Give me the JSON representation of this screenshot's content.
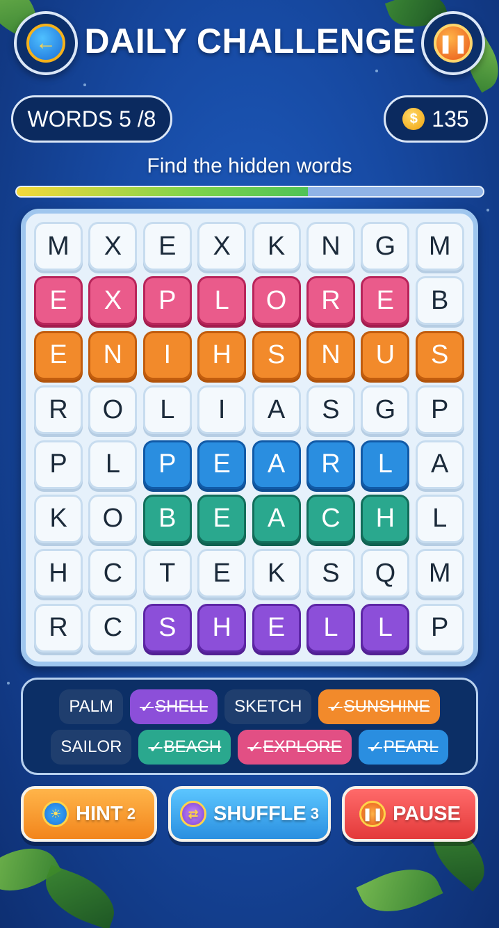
{
  "header": {
    "title": "DAILY CHALLENGE",
    "back_icon": "arrow-left-icon",
    "pause_icon": "pause-icon"
  },
  "status": {
    "words_label": "WORDS 5 /8",
    "coins": "135",
    "coin_symbol": "$"
  },
  "instruction": "Find the hidden words",
  "progress": {
    "fraction": 0.625
  },
  "grid": [
    [
      "M",
      "X",
      "E",
      "X",
      "K",
      "N",
      "G",
      "M"
    ],
    [
      "E",
      "X",
      "P",
      "L",
      "O",
      "R",
      "E",
      "B"
    ],
    [
      "E",
      "N",
      "I",
      "H",
      "S",
      "N",
      "U",
      "S"
    ],
    [
      "R",
      "O",
      "L",
      "I",
      "A",
      "S",
      "G",
      "P"
    ],
    [
      "P",
      "L",
      "P",
      "E",
      "A",
      "R",
      "L",
      "A"
    ],
    [
      "K",
      "O",
      "B",
      "E",
      "A",
      "C",
      "H",
      "L"
    ],
    [
      "H",
      "C",
      "T",
      "E",
      "K",
      "S",
      "Q",
      "M"
    ],
    [
      "R",
      "C",
      "S",
      "H",
      "E",
      "L",
      "L",
      "P"
    ]
  ],
  "highlights": [
    {
      "word": "EXPLORE",
      "color": "#ea5b8b",
      "row": 1,
      "cols": [
        0,
        1,
        2,
        3,
        4,
        5,
        6
      ]
    },
    {
      "word": "SUNSHINE",
      "color": "#f28a2b",
      "row": 2,
      "cols": [
        0,
        1,
        2,
        3,
        4,
        5,
        6,
        7
      ]
    },
    {
      "word": "PEARL",
      "color": "#2a8ee0",
      "row": 4,
      "cols": [
        2,
        3,
        4,
        5,
        6
      ]
    },
    {
      "word": "BEACH",
      "color": "#2aa88e",
      "row": 5,
      "cols": [
        2,
        3,
        4,
        5,
        6
      ]
    },
    {
      "word": "SHELL",
      "color": "#8c4fd9",
      "row": 7,
      "cols": [
        2,
        3,
        4,
        5,
        6
      ]
    }
  ],
  "words_row1": [
    {
      "label": "PALM",
      "found": false,
      "color": "#1f3e6e"
    },
    {
      "label": "SHELL",
      "found": true,
      "color": "#8c4fd9"
    },
    {
      "label": "SKETCH",
      "found": false,
      "color": "#1f3e6e"
    },
    {
      "label": "SUNSHINE",
      "found": true,
      "color": "#f28a2b"
    }
  ],
  "words_row2": [
    {
      "label": "SAILOR",
      "found": false,
      "color": "#1f3e6e"
    },
    {
      "label": "BEACH",
      "found": true,
      "color": "#2aa88e"
    },
    {
      "label": "EXPLORE",
      "found": true,
      "color": "#e24f84"
    },
    {
      "label": "PEARL",
      "found": true,
      "color": "#2a8ee0"
    }
  ],
  "buttons": {
    "hint_label": "HINT",
    "hint_count": "2",
    "hint_icon": "lightbulb-icon",
    "shuffle_label": "SHUFFLE",
    "shuffle_count": "3",
    "shuffle_icon": "shuffle-icon",
    "pause_label": "PAUSE",
    "pause_icon": "pause-icon"
  }
}
